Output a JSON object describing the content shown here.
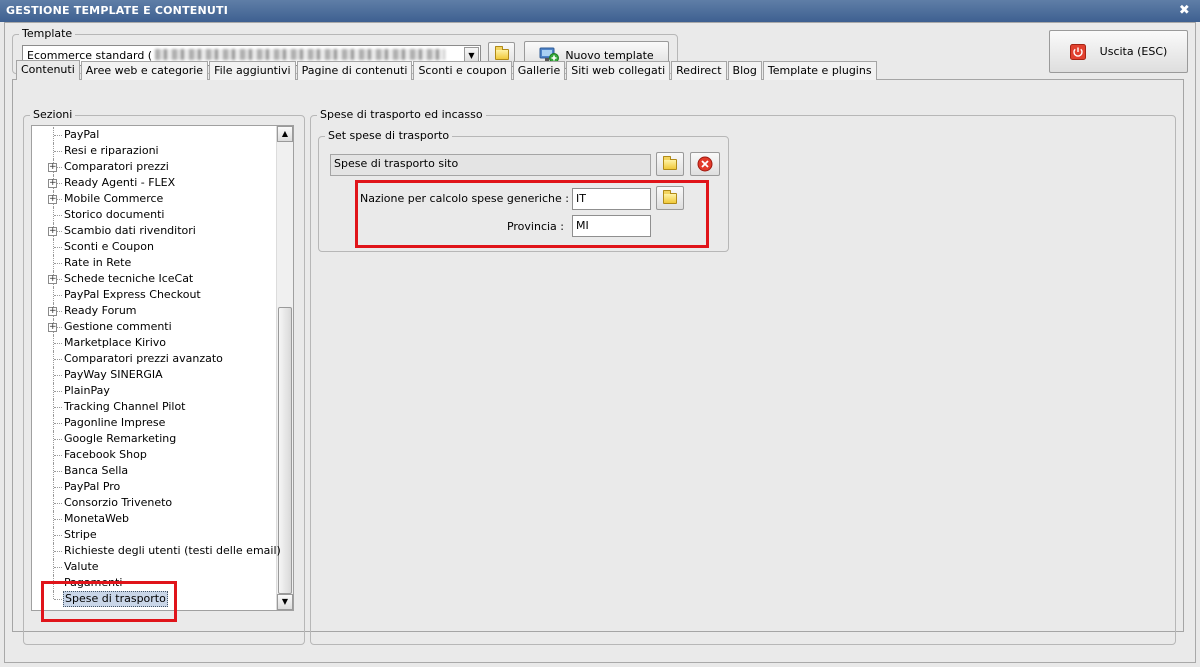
{
  "window": {
    "title": "GESTIONE TEMPLATE E CONTENUTI",
    "close_glyph": "✖"
  },
  "template_group": {
    "label": "Template",
    "combo_value": "Ecommerce standard (",
    "new_template_label": "Nuovo template"
  },
  "exit_button": {
    "label": "Uscita (ESC)"
  },
  "tabs": [
    {
      "label": "Contenuti",
      "active": true
    },
    {
      "label": "Aree web e categorie"
    },
    {
      "label": "File aggiuntivi"
    },
    {
      "label": "Pagine di contenuti"
    },
    {
      "label": "Sconti e coupon"
    },
    {
      "label": "Gallerie"
    },
    {
      "label": "Siti web collegati"
    },
    {
      "label": "Redirect"
    },
    {
      "label": "Blog"
    },
    {
      "label": "Template e plugins"
    }
  ],
  "sections": {
    "label": "Sezioni",
    "items": [
      {
        "label": "PayPal"
      },
      {
        "label": "Resi e riparazioni"
      },
      {
        "label": "Comparatori prezzi",
        "expandable": true
      },
      {
        "label": "Ready Agenti - FLEX",
        "expandable": true
      },
      {
        "label": "Mobile Commerce",
        "expandable": true
      },
      {
        "label": "Storico documenti"
      },
      {
        "label": "Scambio dati rivenditori",
        "expandable": true
      },
      {
        "label": "Sconti e Coupon"
      },
      {
        "label": "Rate in Rete"
      },
      {
        "label": "Schede tecniche IceCat",
        "expandable": true
      },
      {
        "label": "PayPal Express Checkout"
      },
      {
        "label": "Ready Forum",
        "expandable": true
      },
      {
        "label": "Gestione commenti",
        "expandable": true
      },
      {
        "label": "Marketplace Kirivo"
      },
      {
        "label": "Comparatori prezzi avanzato"
      },
      {
        "label": "PayWay SINERGIA"
      },
      {
        "label": "PlainPay"
      },
      {
        "label": "Tracking Channel Pilot"
      },
      {
        "label": "Pagonline Imprese"
      },
      {
        "label": "Google Remarketing"
      },
      {
        "label": "Facebook Shop"
      },
      {
        "label": "Banca Sella"
      },
      {
        "label": "PayPal Pro"
      },
      {
        "label": "Consorzio Triveneto"
      },
      {
        "label": "MonetaWeb"
      },
      {
        "label": "Stripe"
      },
      {
        "label": "Richieste degli utenti (testi delle email)"
      },
      {
        "label": "Valute"
      },
      {
        "label": "Pagamenti"
      },
      {
        "label": "Spese di trasporto",
        "selected": true
      }
    ]
  },
  "shipping": {
    "outer_label": "Spese di trasporto ed incasso",
    "inner_label": "Set spese di trasporto",
    "set_value": "Spese di trasporto sito",
    "nation_label": "Nazione per calcolo spese generiche :",
    "nation_value": "IT",
    "province_label": "Provincia :",
    "province_value": "MI"
  },
  "colors": {
    "titlebar": "#3e6091",
    "highlight": "#e0141a"
  }
}
